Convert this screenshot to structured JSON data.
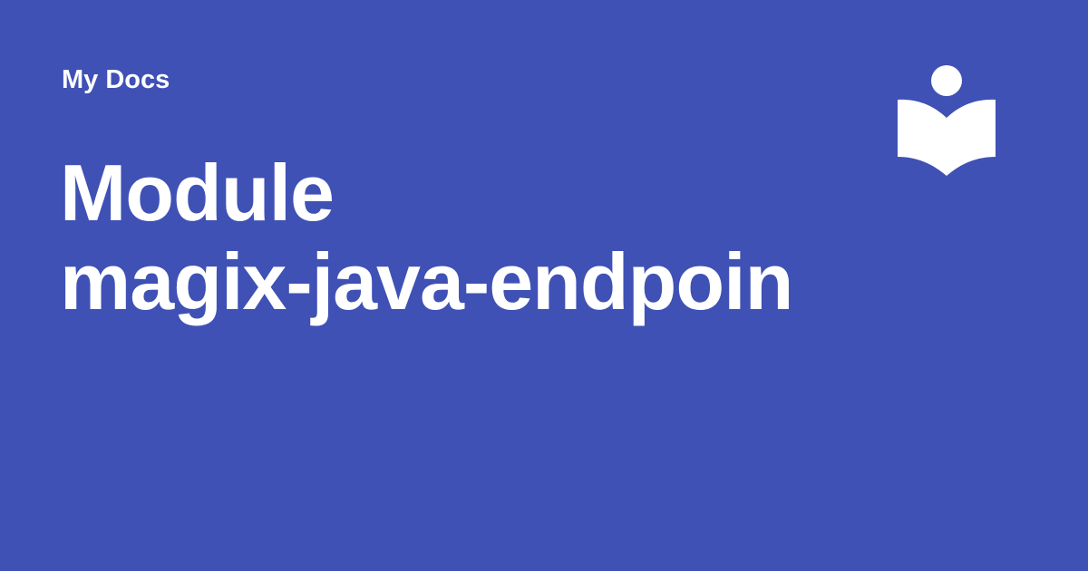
{
  "header": {
    "site_name": "My Docs"
  },
  "main": {
    "title_lines": [
      "Module",
      "magix-java-endpoin"
    ]
  },
  "logo": {
    "icon": "reader-book-icon"
  },
  "colors": {
    "background": "#3f51b5",
    "foreground": "#ffffff"
  }
}
